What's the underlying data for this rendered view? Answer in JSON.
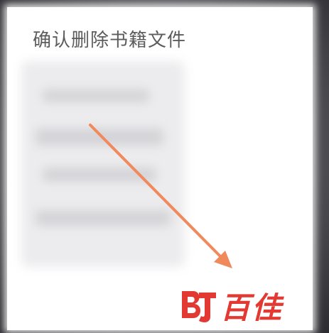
{
  "dialog": {
    "title": "确认删除书籍文件"
  },
  "annotation": {
    "arrow_color": "#f08a5d",
    "icon": "arrow-icon"
  },
  "watermark": {
    "text": "百佳",
    "color": "#e23a33",
    "logo_icon": "bj-logo-icon"
  }
}
